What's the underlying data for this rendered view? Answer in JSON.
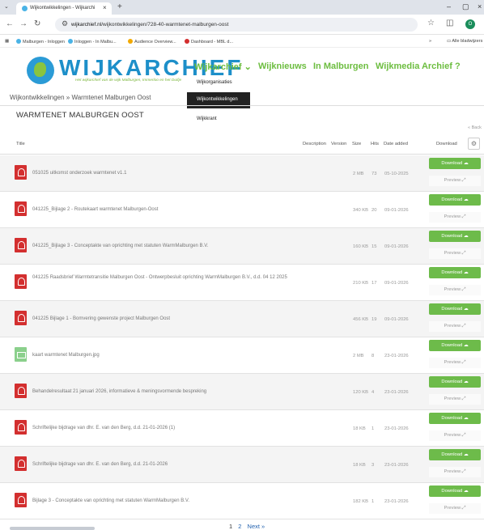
{
  "browser": {
    "tab_title": "Wijkontwikkelingen - Wijkarchi",
    "new_tab": "+",
    "url": "wijkarchief.nl/wijkontwikkelingen/728-40-warmtenet-malburgen-oost",
    "url_domain": "wijkarchief.nl",
    "url_path": "/wijkontwikkelingen/728-40-warmtenet-malburgen-oost",
    "profile_initial": "O",
    "bookmarks": [
      {
        "label": "Malburgen - Inloggen",
        "color": "#4ab3e6"
      },
      {
        "label": "Inloggen - In Malbu...",
        "color": "#4ab3e6"
      },
      {
        "label": "Audience Overview...",
        "color": "#f2a900"
      },
      {
        "label": "Dashboard - MBL d...",
        "color": "#d32f2f"
      }
    ],
    "bookmarks_overflow": "»",
    "all_bookmarks": "Alle bladwijzers"
  },
  "site": {
    "logo_text": "WIJKARCHIEF",
    "logo_tagline": "Het wijkarchief van de wijk Malburgen, Immerloo en het Duifje",
    "nav": [
      {
        "label": "Wijkarchief ⌄"
      },
      {
        "label": "Wijknieuws"
      },
      {
        "label": "In Malburgen"
      },
      {
        "label": "Wijkmedia Archief"
      },
      {
        "label": "?"
      }
    ],
    "dropdown": [
      "Wijkorganisaties",
      "Wijkontwikkelingen",
      "Wijkkrant"
    ],
    "breadcrumb": "Wijkontwikkelingen  »  Warmtenet Malburgen Oost",
    "page_title": "WARMTENET MALBURGEN OOST",
    "back_label": "« Back"
  },
  "table": {
    "headers": {
      "title": "Title",
      "description": "Description",
      "version": "Version",
      "size": "Size",
      "hits": "Hits",
      "date_added": "Date added",
      "download": "Download"
    },
    "download_label": "Download",
    "preview_label": "Preview",
    "rows": [
      {
        "title": "051025 uitkomst onderzoek warmtenet v1.1",
        "size": "2 MB",
        "hits": "73",
        "date": "05-10-2025",
        "type": "pdf"
      },
      {
        "title": "041225_Bijlage 2 - Routekaart warmtenet Malburgen-Oost",
        "size": "340 KB",
        "hits": "20",
        "date": "09-01-2026",
        "type": "pdf"
      },
      {
        "title": "041225_Bijlage 3 - Conceptakte van oprichting met statuten WarmMalburgen B.V.",
        "size": "160 KB",
        "hits": "15",
        "date": "09-01-2026",
        "type": "pdf"
      },
      {
        "title": "041225 Raadsbrief Warmtetransitie Malburgen Oost - Ontwerpbesluit oprichting WarmMalburgen B.V., d.d. 04 12 2025",
        "size": "210 KB",
        "hits": "17",
        "date": "09-01-2026",
        "type": "pdf"
      },
      {
        "title": "041225 Bijlage 1 - Bomvering gewenste project Malburgen Oost",
        "size": "456 KB",
        "hits": "19",
        "date": "09-01-2026",
        "type": "pdf"
      },
      {
        "title": "kaart warmtenet Malburgen.jpg",
        "size": "2 MB",
        "hits": "8",
        "date": "23-01-2026",
        "type": "image"
      },
      {
        "title": "Behandelresultaat 21 januari 2026, informatieve & meningsvormende bespreking",
        "size": "120 KB",
        "hits": "4",
        "date": "23-01-2026",
        "type": "pdf"
      },
      {
        "title": "Schriftelijke bijdrage van dhr. E. van den Berg, d.d. 21-01-2026 (1)",
        "size": "18 KB",
        "hits": "1",
        "date": "23-01-2026",
        "type": "pdf"
      },
      {
        "title": "Schriftelijke bijdrage van dhr. E. van den Berg, d.d. 21-01-2026",
        "size": "18 KB",
        "hits": "3",
        "date": "23-01-2026",
        "type": "pdf"
      },
      {
        "title": "Bijlage 3 - Conceptakte van oprichting met statuten WarmMalburgen B.V.",
        "size": "182 KB",
        "hits": "1",
        "date": "23-01-2026",
        "type": "pdf"
      }
    ]
  },
  "pagination": {
    "pages": [
      "1",
      "2"
    ],
    "next": "Next »"
  },
  "colors": {
    "accent_green": "#6dbb4a",
    "brand_blue": "#1d8fc9",
    "pdf_red": "#d32f2f"
  }
}
